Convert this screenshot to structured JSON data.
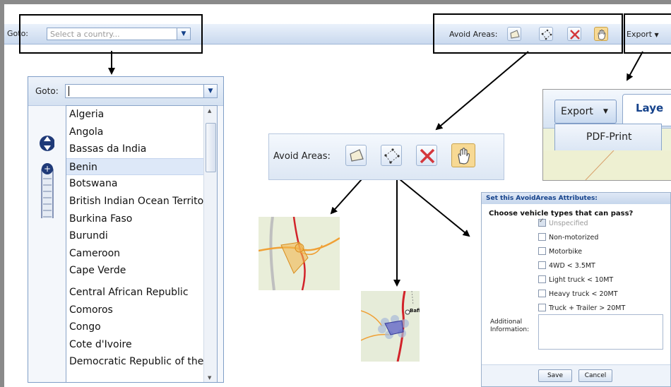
{
  "toolbar": {
    "goto_label": "Goto:",
    "country_placeholder": "Select a country...",
    "avoid_areas_label": "Avoid Areas:",
    "export_label": "Export"
  },
  "goto_dropdown": {
    "label": "Goto:",
    "input_value": "",
    "countries": [
      "Algeria",
      "Angola",
      "Bassas da India",
      "Benin",
      "Botswana",
      "British Indian Ocean Territo",
      "Burkina Faso",
      "Burundi",
      "Cameroon",
      "Cape Verde",
      "Central African Republic",
      "Comoros",
      "Congo",
      "Cote d'Ivoire",
      "Democratic Republic of the"
    ],
    "selected_index": 3
  },
  "avoid_areas_zoom": {
    "label": "Avoid Areas:",
    "tools": [
      "polygon-tool-icon",
      "rectangle-tool-icon",
      "delete-area-icon",
      "pan-hand-icon"
    ]
  },
  "export_zoom": {
    "export_label": "Export",
    "layers_tab": "Laye",
    "menu_item": "PDF-Print"
  },
  "dialog": {
    "title": "Set this AvoidAreas Attributes:",
    "question": "Choose vehicle types that can pass?",
    "options": [
      {
        "label": "Unspecified",
        "checked": true,
        "disabled": true
      },
      {
        "label": "Non-motorized",
        "checked": false
      },
      {
        "label": "Motorbike",
        "checked": false
      },
      {
        "label": "4WD < 3.5MT",
        "checked": false
      },
      {
        "label": "Light truck < 10MT",
        "checked": false
      },
      {
        "label": "Heavy truck < 20MT",
        "checked": false
      },
      {
        "label": "Truck + Trailer > 20MT",
        "checked": false
      }
    ],
    "additional_label_1": "Additional",
    "additional_label_2": "Information:",
    "additional_value": "",
    "save_label": "Save",
    "cancel_label": "Cancel"
  },
  "map2": {
    "place_label": "Bafilo"
  },
  "colors": {
    "toolbar_top": "#eaf1fb",
    "toolbar_bottom": "#c9d9ee",
    "accent": "#15428b",
    "active_tool": "#f7d994",
    "road": "#d2232a",
    "road_secondary": "#f0a035"
  }
}
